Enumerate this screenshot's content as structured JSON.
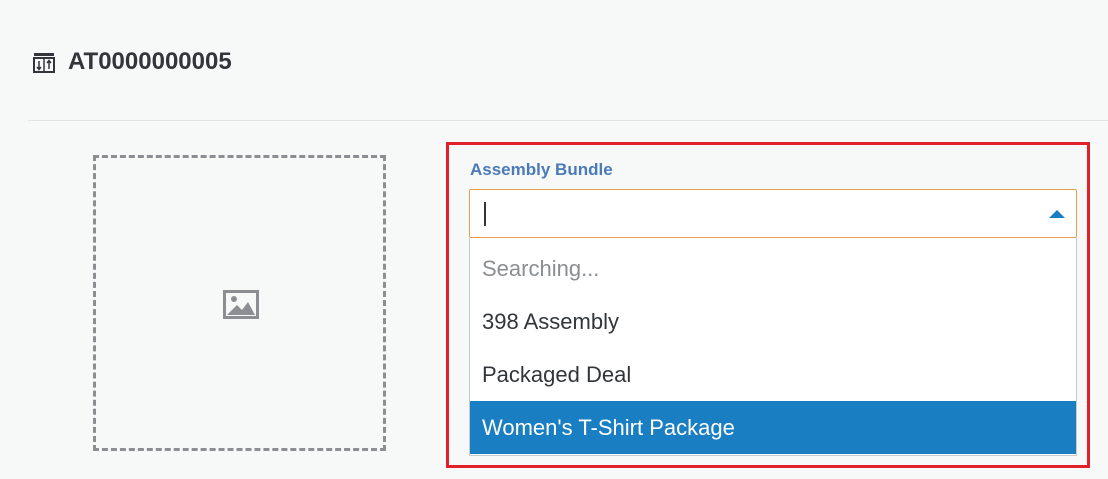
{
  "header": {
    "title": "AT0000000005",
    "icon": "table-icon"
  },
  "image_placeholder": {
    "icon": "image-icon"
  },
  "assembly_field": {
    "label": "Assembly Bundle",
    "input_value": "",
    "dropdown_open": true,
    "options": [
      {
        "label": "Searching...",
        "state": "status"
      },
      {
        "label": "398 Assembly",
        "state": "normal"
      },
      {
        "label": "Packaged Deal",
        "state": "normal"
      },
      {
        "label": "Women's T-Shirt Package",
        "state": "selected"
      }
    ]
  },
  "colors": {
    "label_blue": "#4a7ab7",
    "focus_orange": "#e8a04f",
    "selected_blue": "#1a7ec2",
    "highlight_red": "#e0202a"
  }
}
